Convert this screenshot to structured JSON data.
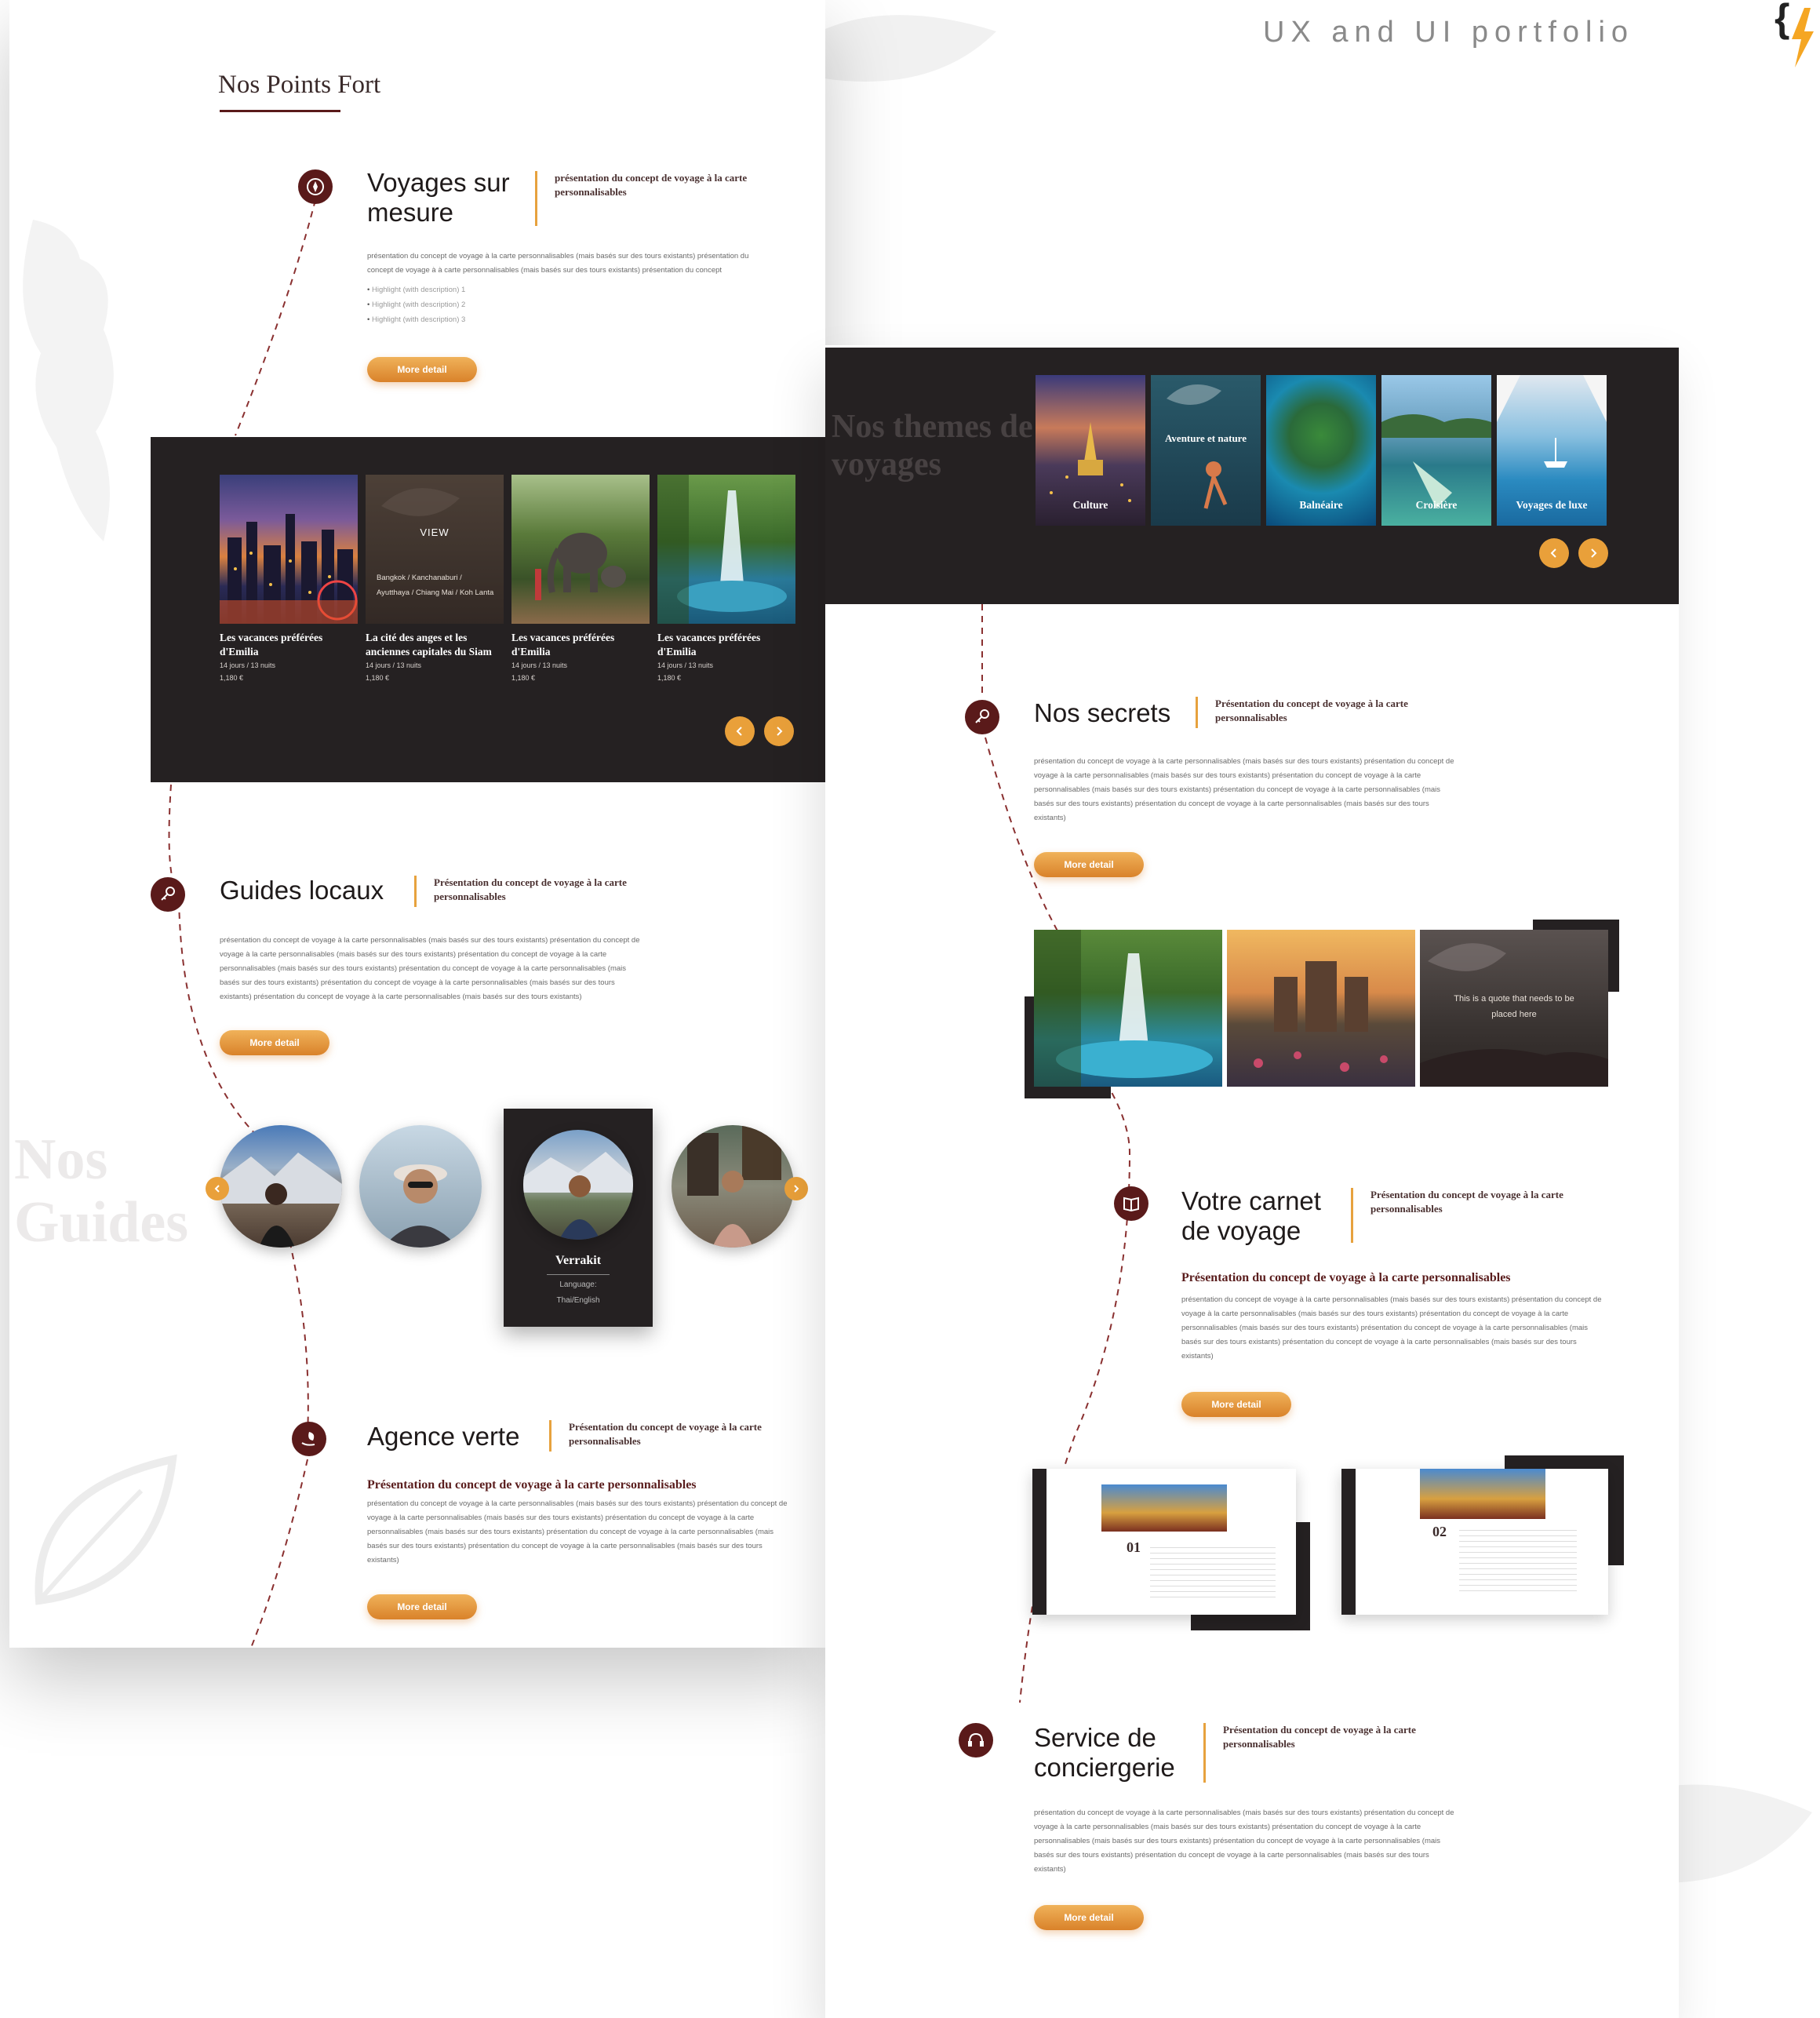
{
  "header": {
    "portfolio_label": "UX and UI portfolio"
  },
  "left_page": {
    "heading": "Nos Points Fort",
    "voyages": {
      "title": "Voyages sur mesure",
      "subtitle": "présentation du concept de voyage à la carte personnalisables",
      "body": "présentation du concept de voyage à la carte personnalisables (mais basés sur des tours existants) présentation du concept de voyage à à carte personnalisables (mais basés sur des tours existants) présentation du concept",
      "bullets": [
        "Highlight (with description) 1",
        "Highlight (with description) 2",
        "Highlight (with description) 3"
      ],
      "button": "More detail"
    },
    "tours": [
      {
        "title": "Les vacances préférées d'Emilia",
        "duration": "14 jours / 13 nuits",
        "price": "1,180 €",
        "overlay": ""
      },
      {
        "title": "La cité des anges et les anciennes capitales du Siam",
        "duration": "14 jours / 13 nuits",
        "price": "1,180 €",
        "overlay": "VIEW",
        "overlay_sub": "Bangkok / Kanchanaburi / Ayutthaya / Chiang Mai / Koh Lanta"
      },
      {
        "title": "Les vacances préférées d'Emilia",
        "duration": "14 jours / 13 nuits",
        "price": "1,180 €",
        "overlay": ""
      },
      {
        "title": "Les vacances préférées d'Emilia",
        "duration": "14 jours / 13 nuits",
        "price": "1,180 €",
        "overlay": ""
      }
    ],
    "guides_locaux": {
      "title": "Guides locaux",
      "subtitle": "Présentation du concept de voyage à la carte personnalisables",
      "body": "présentation du concept de voyage à la carte personnalisables (mais basés sur des tours existants) présentation du concept de voyage à la carte personnalisables (mais basés sur des tours existants) présentation du concept de voyage à la carte personnalisables (mais basés sur des tours existants) présentation du concept de voyage à la carte personnalisables (mais basés sur des tours existants) présentation du concept de voyage à la carte personnalisables (mais basés sur des tours existants) présentation du concept de voyage à la carte personnalisables (mais basés sur des tours existants)",
      "button": "More detail"
    },
    "nos_guides_watermark": "Nos Guides",
    "featured_guide": {
      "name": "Verrakit",
      "language_label": "Language:",
      "language": "Thai/English"
    },
    "agence_verte": {
      "title": "Agence verte",
      "subtitle": "Présentation du concept de voyage à la carte personnalisables",
      "bold": "Présentation du concept de voyage à la carte personnalisables",
      "body": "présentation du concept de voyage à la carte personnalisables (mais basés sur des tours existants) présentation du concept de voyage à la carte personnalisables (mais basés sur des tours existants) présentation du concept de voyage à la carte personnalisables (mais basés sur des tours existants) présentation du concept de voyage à la carte personnalisables (mais basés sur des tours existants) présentation du concept de voyage à la carte personnalisables (mais basés sur des tours existants)",
      "button": "More detail"
    }
  },
  "right_page": {
    "themes_watermark": "Nos themes de voyages",
    "themes": [
      "Culture",
      "Aventure et nature",
      "Balnéaire",
      "Croisière",
      "Voyages de luxe"
    ],
    "nos_secrets": {
      "title": "Nos secrets",
      "subtitle": "Présentation du concept de voyage à la carte personnalisables",
      "body": "présentation du concept de voyage à la carte personnalisables (mais basés sur des tours existants) présentation du concept de voyage à la carte personnalisables (mais basés sur des tours existants) présentation du concept de voyage à la carte personnalisables (mais basés sur des tours existants) présentation du concept de voyage à la carte personnalisables (mais basés sur des tours existants) présentation du concept de voyage à la carte personnalisables (mais basés sur des tours existants)",
      "button": "More detail"
    },
    "quote": "This is a quote that needs to be placed here",
    "carnet": {
      "title": "Votre carnet de voyage",
      "subtitle": "Présentation du concept de voyage à la carte personnalisables",
      "bold": "Présentation du concept de voyage à la carte personnalisables",
      "body": "présentation du concept de voyage à la carte personnalisables (mais basés sur des tours existants) présentation du concept de voyage à la carte personnalisables (mais basés sur des tours existants) présentation du concept de voyage à la carte personnalisables (mais basés sur des tours existants) présentation du concept de voyage à la carte personnalisables (mais basés sur des tours existants) présentation du concept de voyage à la carte personnalisables (mais basés sur des tours existants)",
      "button": "More detail",
      "page_numbers": [
        "01",
        "02"
      ]
    },
    "conciergerie": {
      "title": "Service de conciergerie",
      "subtitle": "Présentation du concept de voyage à la carte personnalisables",
      "body": "présentation du concept de voyage à la carte personnalisables (mais basés sur des tours existants) présentation du concept de voyage à la carte personnalisables (mais basés sur des tours existants) présentation du concept de voyage à la carte personnalisables (mais basés sur des tours existants) présentation du concept de voyage à la carte personnalisables (mais basés sur des tours existants) présentation du concept de voyage à la carte personnalisables (mais basés sur des tours existants)",
      "button": "More detail"
    }
  },
  "colors": {
    "accent": "#e9a03a",
    "brand": "#5a1a1a",
    "dark": "#252122"
  },
  "icons": [
    "compass-icon",
    "key-icon",
    "leaf-hand-icon",
    "book-icon",
    "headset-icon",
    "chevron-left-icon",
    "chevron-right-icon",
    "logo-icon"
  ]
}
